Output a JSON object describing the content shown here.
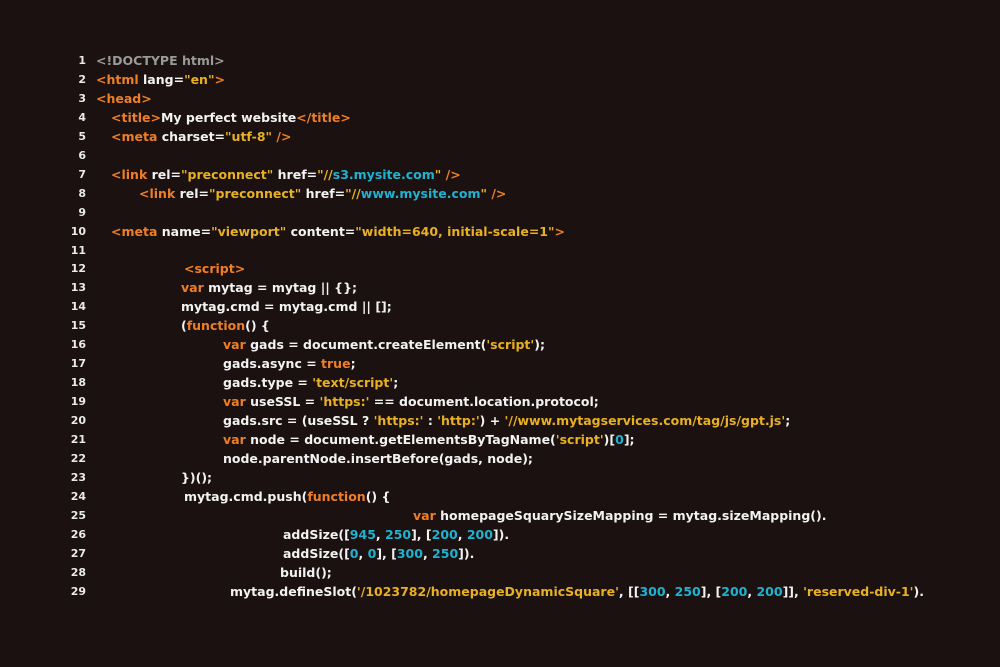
{
  "theme": {
    "background": "#1a1110",
    "text": "#f2f2f2",
    "tag": "#ef7f26",
    "keyword": "#ef7f26",
    "string": "#e8b023",
    "number": "#1fb3d1",
    "doctype": "#9a9a9a",
    "line_number": "#eaeaea"
  },
  "lines": [
    {
      "n": "1",
      "tokens": [
        {
          "t": "doctype",
          "v": "<!DOCTYPE html>"
        }
      ]
    },
    {
      "n": "2",
      "tokens": [
        {
          "t": "tag",
          "v": "<html "
        },
        {
          "t": "attr",
          "v": "lang="
        },
        {
          "t": "str",
          "v": "\"en\""
        },
        {
          "t": "tag",
          "v": ">"
        }
      ]
    },
    {
      "n": "3",
      "tokens": [
        {
          "t": "tag",
          "v": "<head>"
        }
      ]
    },
    {
      "n": "4",
      "tokens": [
        {
          "t": "tag",
          "v": "<title>"
        },
        {
          "t": "plain",
          "v": "My perfect website"
        },
        {
          "t": "tag",
          "v": "</title>"
        }
      ]
    },
    {
      "n": "5",
      "tokens": [
        {
          "t": "tag",
          "v": "<meta "
        },
        {
          "t": "attr",
          "v": "charset="
        },
        {
          "t": "str",
          "v": "\"utf-8\""
        },
        {
          "t": "tag",
          "v": " />"
        }
      ]
    },
    {
      "n": "6",
      "tokens": []
    },
    {
      "n": "7",
      "tokens": [
        {
          "t": "tag",
          "v": "<link "
        },
        {
          "t": "attr",
          "v": "rel="
        },
        {
          "t": "str",
          "v": "\"preconnect\""
        },
        {
          "t": "attr",
          "v": " href="
        },
        {
          "t": "str",
          "v": "\"//"
        },
        {
          "t": "num",
          "v": "s3.mysite.com"
        },
        {
          "t": "str",
          "v": "\""
        },
        {
          "t": "tag",
          "v": " />"
        }
      ]
    },
    {
      "n": "8",
      "tokens": [
        {
          "t": "tag",
          "v": "<link "
        },
        {
          "t": "attr",
          "v": "rel="
        },
        {
          "t": "str",
          "v": "\"preconnect\""
        },
        {
          "t": "attr",
          "v": " href="
        },
        {
          "t": "str",
          "v": "\"//"
        },
        {
          "t": "num",
          "v": "www.mysite.com"
        },
        {
          "t": "str",
          "v": "\""
        },
        {
          "t": "tag",
          "v": " />"
        }
      ]
    },
    {
      "n": "9",
      "tokens": []
    },
    {
      "n": "10",
      "tokens": [
        {
          "t": "tag",
          "v": "<meta "
        },
        {
          "t": "attr",
          "v": "name="
        },
        {
          "t": "str",
          "v": "\"viewport\""
        },
        {
          "t": "attr",
          "v": " content="
        },
        {
          "t": "str",
          "v": "\"width=640, initial-scale=1\""
        },
        {
          "t": "tag",
          "v": ">"
        }
      ]
    },
    {
      "n": "11",
      "tokens": []
    },
    {
      "n": "12",
      "tokens": [
        {
          "t": "tag",
          "v": "<script>"
        }
      ]
    },
    {
      "n": "13",
      "tokens": [
        {
          "t": "kw",
          "v": "var "
        },
        {
          "t": "plain",
          "v": "mytag = mytag || {};"
        }
      ]
    },
    {
      "n": "14",
      "tokens": [
        {
          "t": "plain",
          "v": "mytag.cmd = mytag.cmd || [];"
        }
      ]
    },
    {
      "n": "15",
      "tokens": [
        {
          "t": "plain",
          "v": "("
        },
        {
          "t": "kw",
          "v": "function"
        },
        {
          "t": "plain",
          "v": "() {"
        }
      ]
    },
    {
      "n": "16",
      "tokens": [
        {
          "t": "kw",
          "v": "var "
        },
        {
          "t": "plain",
          "v": "gads = document.createElement("
        },
        {
          "t": "str",
          "v": "'script'"
        },
        {
          "t": "plain",
          "v": ");"
        }
      ]
    },
    {
      "n": "17",
      "tokens": [
        {
          "t": "plain",
          "v": "gads.async = "
        },
        {
          "t": "kw",
          "v": "true"
        },
        {
          "t": "plain",
          "v": ";"
        }
      ]
    },
    {
      "n": "18",
      "tokens": [
        {
          "t": "plain",
          "v": "gads.type = "
        },
        {
          "t": "str",
          "v": "'text/script'"
        },
        {
          "t": "plain",
          "v": ";"
        }
      ]
    },
    {
      "n": "19",
      "tokens": [
        {
          "t": "kw",
          "v": "var "
        },
        {
          "t": "plain",
          "v": "useSSL = "
        },
        {
          "t": "str",
          "v": "'https:'"
        },
        {
          "t": "plain",
          "v": " == document.location.protocol;"
        }
      ]
    },
    {
      "n": "20",
      "tokens": [
        {
          "t": "plain",
          "v": "gads.src = (useSSL ? "
        },
        {
          "t": "str",
          "v": "'https:'"
        },
        {
          "t": "plain",
          "v": " : "
        },
        {
          "t": "str",
          "v": "'http:'"
        },
        {
          "t": "plain",
          "v": ") + "
        },
        {
          "t": "str",
          "v": "'//www.mytagservices.com/tag/js/gpt.js'"
        },
        {
          "t": "plain",
          "v": ";"
        }
      ]
    },
    {
      "n": "21",
      "tokens": [
        {
          "t": "kw",
          "v": "var "
        },
        {
          "t": "plain",
          "v": "node = document.getElementsByTagName("
        },
        {
          "t": "str",
          "v": "'script'"
        },
        {
          "t": "plain",
          "v": ")["
        },
        {
          "t": "num",
          "v": "0"
        },
        {
          "t": "plain",
          "v": "];"
        }
      ]
    },
    {
      "n": "22",
      "tokens": [
        {
          "t": "plain",
          "v": "node.parentNode.insertBefore(gads, node);"
        }
      ]
    },
    {
      "n": "23",
      "tokens": [
        {
          "t": "plain",
          "v": "})();"
        }
      ]
    },
    {
      "n": "24",
      "tokens": [
        {
          "t": "plain",
          "v": "mytag.cmd.push("
        },
        {
          "t": "kw",
          "v": "function"
        },
        {
          "t": "plain",
          "v": "() {"
        }
      ]
    },
    {
      "n": "25",
      "tokens": [
        {
          "t": "kw",
          "v": "var "
        },
        {
          "t": "plain",
          "v": "homepageSquarySizeMapping = mytag.sizeMapping()."
        }
      ]
    },
    {
      "n": "26",
      "tokens": [
        {
          "t": "plain",
          "v": "addSize(["
        },
        {
          "t": "num",
          "v": "945"
        },
        {
          "t": "plain",
          "v": ", "
        },
        {
          "t": "num",
          "v": "250"
        },
        {
          "t": "plain",
          "v": "], ["
        },
        {
          "t": "num",
          "v": "200"
        },
        {
          "t": "plain",
          "v": ", "
        },
        {
          "t": "num",
          "v": "200"
        },
        {
          "t": "plain",
          "v": "])."
        }
      ]
    },
    {
      "n": "27",
      "tokens": [
        {
          "t": "plain",
          "v": "addSize(["
        },
        {
          "t": "num",
          "v": "0"
        },
        {
          "t": "plain",
          "v": ", "
        },
        {
          "t": "num",
          "v": "0"
        },
        {
          "t": "plain",
          "v": "], ["
        },
        {
          "t": "num",
          "v": "300"
        },
        {
          "t": "plain",
          "v": ", "
        },
        {
          "t": "num",
          "v": "250"
        },
        {
          "t": "plain",
          "v": "])."
        }
      ]
    },
    {
      "n": "28",
      "tokens": [
        {
          "t": "plain",
          "v": "build();"
        }
      ]
    },
    {
      "n": "29",
      "tokens": [
        {
          "t": "plain",
          "v": "mytag.defineSlot("
        },
        {
          "t": "str",
          "v": "'/1023782/homepageDynamicSquare'"
        },
        {
          "t": "plain",
          "v": ", [["
        },
        {
          "t": "num",
          "v": "300"
        },
        {
          "t": "plain",
          "v": ", "
        },
        {
          "t": "num",
          "v": "250"
        },
        {
          "t": "plain",
          "v": "], ["
        },
        {
          "t": "num",
          "v": "200"
        },
        {
          "t": "plain",
          "v": ", "
        },
        {
          "t": "num",
          "v": "200"
        },
        {
          "t": "plain",
          "v": "]], "
        },
        {
          "t": "str",
          "v": "'reserved-div-1'"
        },
        {
          "t": "plain",
          "v": ")."
        }
      ]
    }
  ]
}
